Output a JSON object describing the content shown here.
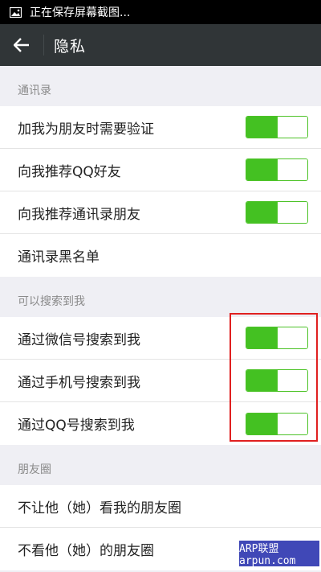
{
  "status_bar": {
    "text": "正在保存屏幕截图..."
  },
  "header": {
    "title": "隐私"
  },
  "sections": [
    {
      "label": "通讯录",
      "items": [
        {
          "label": "加我为朋友时需要验证",
          "toggle": true,
          "value": 0.5
        },
        {
          "label": "向我推荐QQ好友",
          "toggle": true,
          "value": 0.5
        },
        {
          "label": "向我推荐通讯录朋友",
          "toggle": true,
          "value": 0.5
        },
        {
          "label": "通讯录黑名单",
          "toggle": false
        }
      ]
    },
    {
      "label": "可以搜索到我",
      "items": [
        {
          "label": "通过微信号搜索到我",
          "toggle": true
        },
        {
          "label": "通过手机号搜索到我",
          "toggle": true
        },
        {
          "label": "通过QQ号搜索到我",
          "toggle": true
        }
      ]
    },
    {
      "label": "朋友圈",
      "items": [
        {
          "label": "不让他（她）看我的朋友圈",
          "toggle": false
        },
        {
          "label": "不看他（她）的朋友圈",
          "toggle": false
        }
      ]
    }
  ],
  "watermark": {
    "text": "ARP联盟 arpun.com"
  },
  "colors": {
    "accent": "#44c122",
    "titlebar": "#303537",
    "highlight": "#e02020"
  }
}
